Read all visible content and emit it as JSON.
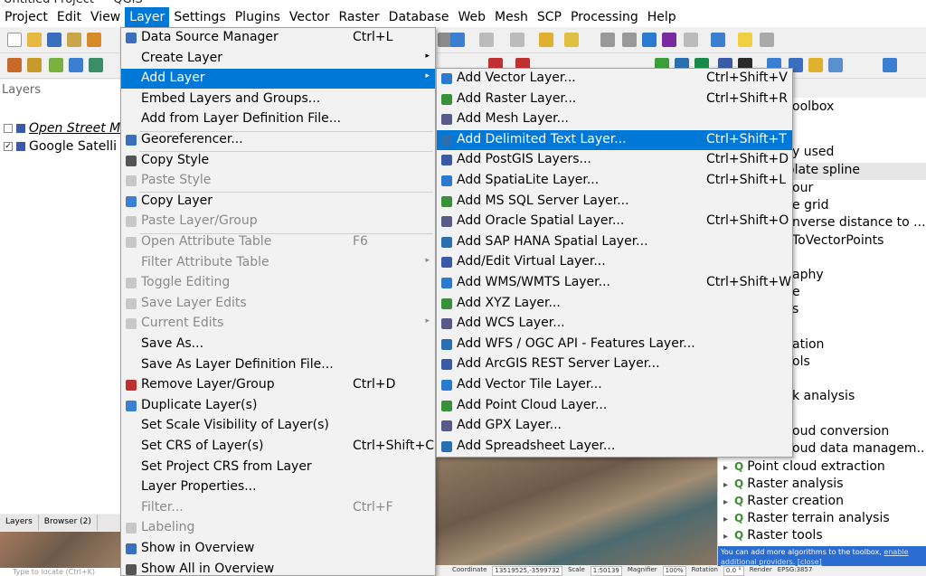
{
  "window": {
    "title": "Untitled Project — QGIS"
  },
  "menubar": [
    "Project",
    "Edit",
    "View",
    "Layer",
    "Settings",
    "Plugins",
    "Vector",
    "Raster",
    "Database",
    "Web",
    "Mesh",
    "SCP",
    "Processing",
    "Help"
  ],
  "layers_panel": {
    "title": "Layers",
    "layers": [
      {
        "name": "Open Street M",
        "checked": false
      },
      {
        "name": "Google Satelli",
        "checked": true
      }
    ],
    "tabs": [
      "Layers",
      "Browser (2)"
    ],
    "locate_placeholder": "Type to locate (Ctrl+K)"
  },
  "layer_menu": {
    "items": [
      {
        "label": "Data Source Manager",
        "shortcut": "Ctrl+L",
        "icon": "data-source-manager-icon"
      },
      {
        "label": "Create Layer",
        "submenu": true
      },
      {
        "label": "Add Layer",
        "submenu": true,
        "highlighted": true
      },
      {
        "label": "Embed Layers and Groups...",
        "sep_after": false
      },
      {
        "label": "Add from Layer Definition File...",
        "sep_after": true
      },
      {
        "label": "Georeferencer...",
        "icon": "georeferencer-icon",
        "sep_after": true
      },
      {
        "label": "Copy Style",
        "icon": "copy-style-icon"
      },
      {
        "label": "Paste Style",
        "icon": "paste-style-icon",
        "disabled": true,
        "sep_after": true
      },
      {
        "label": "Copy Layer",
        "icon": "copy-layer-icon"
      },
      {
        "label": "Paste Layer/Group",
        "icon": "paste-layer-icon",
        "disabled": true,
        "sep_after": true
      },
      {
        "label": "Open Attribute Table",
        "shortcut": "F6",
        "icon": "attribute-table-icon",
        "disabled": true
      },
      {
        "label": "Filter Attribute Table",
        "submenu": true,
        "disabled": true
      },
      {
        "label": "Toggle Editing",
        "icon": "pencil-icon",
        "disabled": true
      },
      {
        "label": "Save Layer Edits",
        "icon": "save-edits-icon",
        "disabled": true
      },
      {
        "label": "Current Edits",
        "submenu": true,
        "icon": "current-edits-icon",
        "disabled": true
      },
      {
        "label": "Save As..."
      },
      {
        "label": "Save As Layer Definition File..."
      },
      {
        "label": "Remove Layer/Group",
        "shortcut": "Ctrl+D",
        "icon": "remove-layer-icon"
      },
      {
        "label": "Duplicate Layer(s)",
        "icon": "duplicate-layer-icon"
      },
      {
        "label": "Set Scale Visibility of Layer(s)"
      },
      {
        "label": "Set CRS of Layer(s)",
        "shortcut": "Ctrl+Shift+C"
      },
      {
        "label": "Set Project CRS from Layer"
      },
      {
        "label": "Layer Properties..."
      },
      {
        "label": "Filter...",
        "shortcut": "Ctrl+F",
        "disabled": true
      },
      {
        "label": "Labeling",
        "icon": "labeling-icon",
        "disabled": true
      },
      {
        "label": "Show in Overview",
        "icon": "overview-icon"
      },
      {
        "label": "Show All in Overview",
        "icon": "overview-all-icon"
      }
    ]
  },
  "add_layer_menu": {
    "items": [
      {
        "label": "Add Vector Layer...",
        "shortcut": "Ctrl+Shift+V",
        "icon": "vector-layer-icon"
      },
      {
        "label": "Add Raster Layer...",
        "shortcut": "Ctrl+Shift+R",
        "icon": "raster-layer-icon"
      },
      {
        "label": "Add Mesh Layer...",
        "icon": "mesh-layer-icon"
      },
      {
        "label": "Add Delimited Text Layer...",
        "shortcut": "Ctrl+Shift+T",
        "icon": "delimited-text-icon",
        "highlighted": true
      },
      {
        "label": "Add PostGIS Layers...",
        "shortcut": "Ctrl+Shift+D",
        "icon": "postgis-icon"
      },
      {
        "label": "Add SpatiaLite Layer...",
        "shortcut": "Ctrl+Shift+L",
        "icon": "spatialite-icon"
      },
      {
        "label": "Add MS SQL Server Layer...",
        "icon": "mssql-icon"
      },
      {
        "label": "Add Oracle Spatial Layer...",
        "shortcut": "Ctrl+Shift+O",
        "icon": "oracle-icon"
      },
      {
        "label": "Add SAP HANA Spatial Layer...",
        "icon": "sap-hana-icon"
      },
      {
        "label": "Add/Edit Virtual Layer...",
        "icon": "virtual-layer-icon"
      },
      {
        "label": "Add WMS/WMTS Layer...",
        "shortcut": "Ctrl+Shift+W",
        "icon": "wms-icon"
      },
      {
        "label": "Add XYZ Layer...",
        "icon": "xyz-icon"
      },
      {
        "label": "Add WCS Layer...",
        "icon": "wcs-icon"
      },
      {
        "label": "Add WFS / OGC API - Features Layer...",
        "icon": "wfs-icon"
      },
      {
        "label": "Add ArcGIS REST Server Layer...",
        "icon": "arcgis-icon"
      },
      {
        "label": "Add Vector Tile Layer...",
        "icon": "vector-tile-icon"
      },
      {
        "label": "Add Point Cloud Layer...",
        "icon": "point-cloud-icon"
      },
      {
        "label": "Add GPX Layer...",
        "icon": "gpx-icon"
      },
      {
        "label": "Add Spreadsheet Layer...",
        "icon": "spreadsheet-icon"
      }
    ]
  },
  "toolbox": {
    "title": "oolbox",
    "partial_items": [
      "y used",
      "olate spline",
      "our",
      "e grid",
      "nverse distance to ...",
      "ToVectorPoints",
      "aphy",
      "e",
      "s",
      "ation",
      "ols",
      "k analysis",
      "oud conversion",
      "oud data managem..."
    ],
    "items": [
      "Point cloud extraction",
      "Raster analysis",
      "Raster creation",
      "Raster terrain analysis",
      "Raster tools"
    ],
    "note": "You can add more algorithms to the toolbox,",
    "note_link": "enable additional providers.",
    "note_close": "[close]"
  },
  "statusbar": {
    "coordinate_label": "Coordinate",
    "coordinate": "13519525,-3599732",
    "scale_label": "Scale",
    "scale": "1:50139",
    "magnifier_label": "Magnifier",
    "magnifier": "100%",
    "rotation_label": "Rotation",
    "rotation": "0.0 °",
    "render_label": "Render",
    "crs": "EPSG:3857"
  },
  "colors": {
    "accent": "#0078d7",
    "menu_bg": "#f2f2f2",
    "disabled": "#8a8a8a"
  }
}
